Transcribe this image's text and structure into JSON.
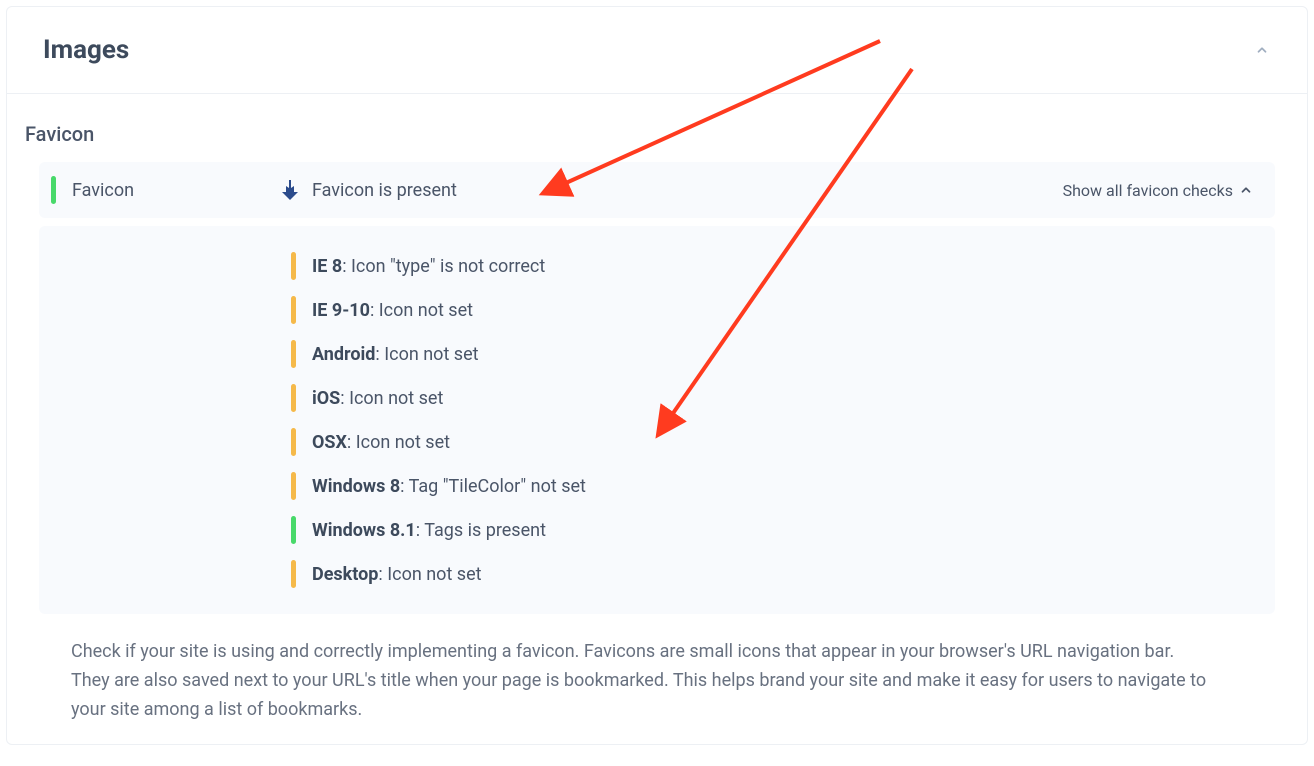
{
  "header": {
    "title": "Images"
  },
  "favicon": {
    "section_title": "Favicon",
    "summary_label": "Favicon",
    "summary_text": "Favicon is present",
    "show_all_label": "Show all favicon checks",
    "checks": [
      {
        "status": "orange",
        "platform": "IE 8",
        "message": "Icon \"type\" is not correct"
      },
      {
        "status": "orange",
        "platform": "IE 9-10",
        "message": "Icon not set"
      },
      {
        "status": "orange",
        "platform": "Android",
        "message": "Icon not set"
      },
      {
        "status": "orange",
        "platform": "iOS",
        "message": "Icon not set"
      },
      {
        "status": "orange",
        "platform": "OSX",
        "message": "Icon not set"
      },
      {
        "status": "orange",
        "platform": "Windows 8",
        "message": "Tag \"TileColor\" not set"
      },
      {
        "status": "green",
        "platform": "Windows 8.1",
        "message": "Tags is present"
      },
      {
        "status": "orange",
        "platform": "Desktop",
        "message": "Icon not set"
      }
    ],
    "description_p1": "Check if your site is using and correctly implementing a favicon. Favicons are small icons that appear in your browser's URL navigation bar.",
    "description_p2": "They are also saved next to your URL's title when your page is bookmarked. This helps brand your site and make it easy for users to navigate to your site among a list of bookmarks."
  },
  "colors": {
    "arrow": "#ff3b1f"
  }
}
